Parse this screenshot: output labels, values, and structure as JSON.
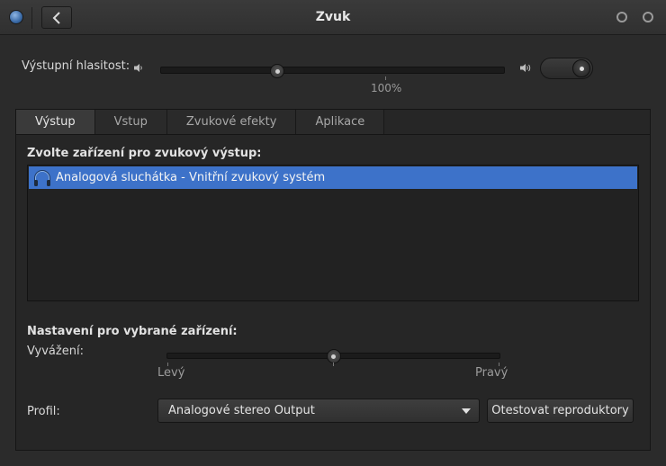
{
  "window": {
    "title": "Zvuk",
    "back_label": "‹"
  },
  "output": {
    "volume_label": "Výstupní hlasitost:",
    "volume_value": 0.34,
    "volume_percent_label": "100%",
    "mute_toggle_on": true
  },
  "tabs": [
    {
      "label": "Výstup",
      "active": true
    },
    {
      "label": "Vstup",
      "active": false
    },
    {
      "label": "Zvukové efekty",
      "active": false
    },
    {
      "label": "Aplikace",
      "active": false
    }
  ],
  "device_section": {
    "heading": "Zvolte zařízení pro zvukový výstup:",
    "devices": [
      {
        "label": "Analogová sluchátka - Vnitřní zvukový systém",
        "selected": true,
        "icon": "headphones-icon"
      }
    ]
  },
  "settings": {
    "heading": "Nastavení pro vybrané zařízení:",
    "balance_label": "Vyvážení:",
    "balance_value": 0.5,
    "balance_left": "Levý",
    "balance_right": "Pravý",
    "profile_label": "Profil:",
    "profile_value": "Analogové stereo Output",
    "test_button": "Otestovat reproduktory"
  },
  "colors": {
    "selection": "#3d72c9",
    "background": "#2b2b2b"
  }
}
